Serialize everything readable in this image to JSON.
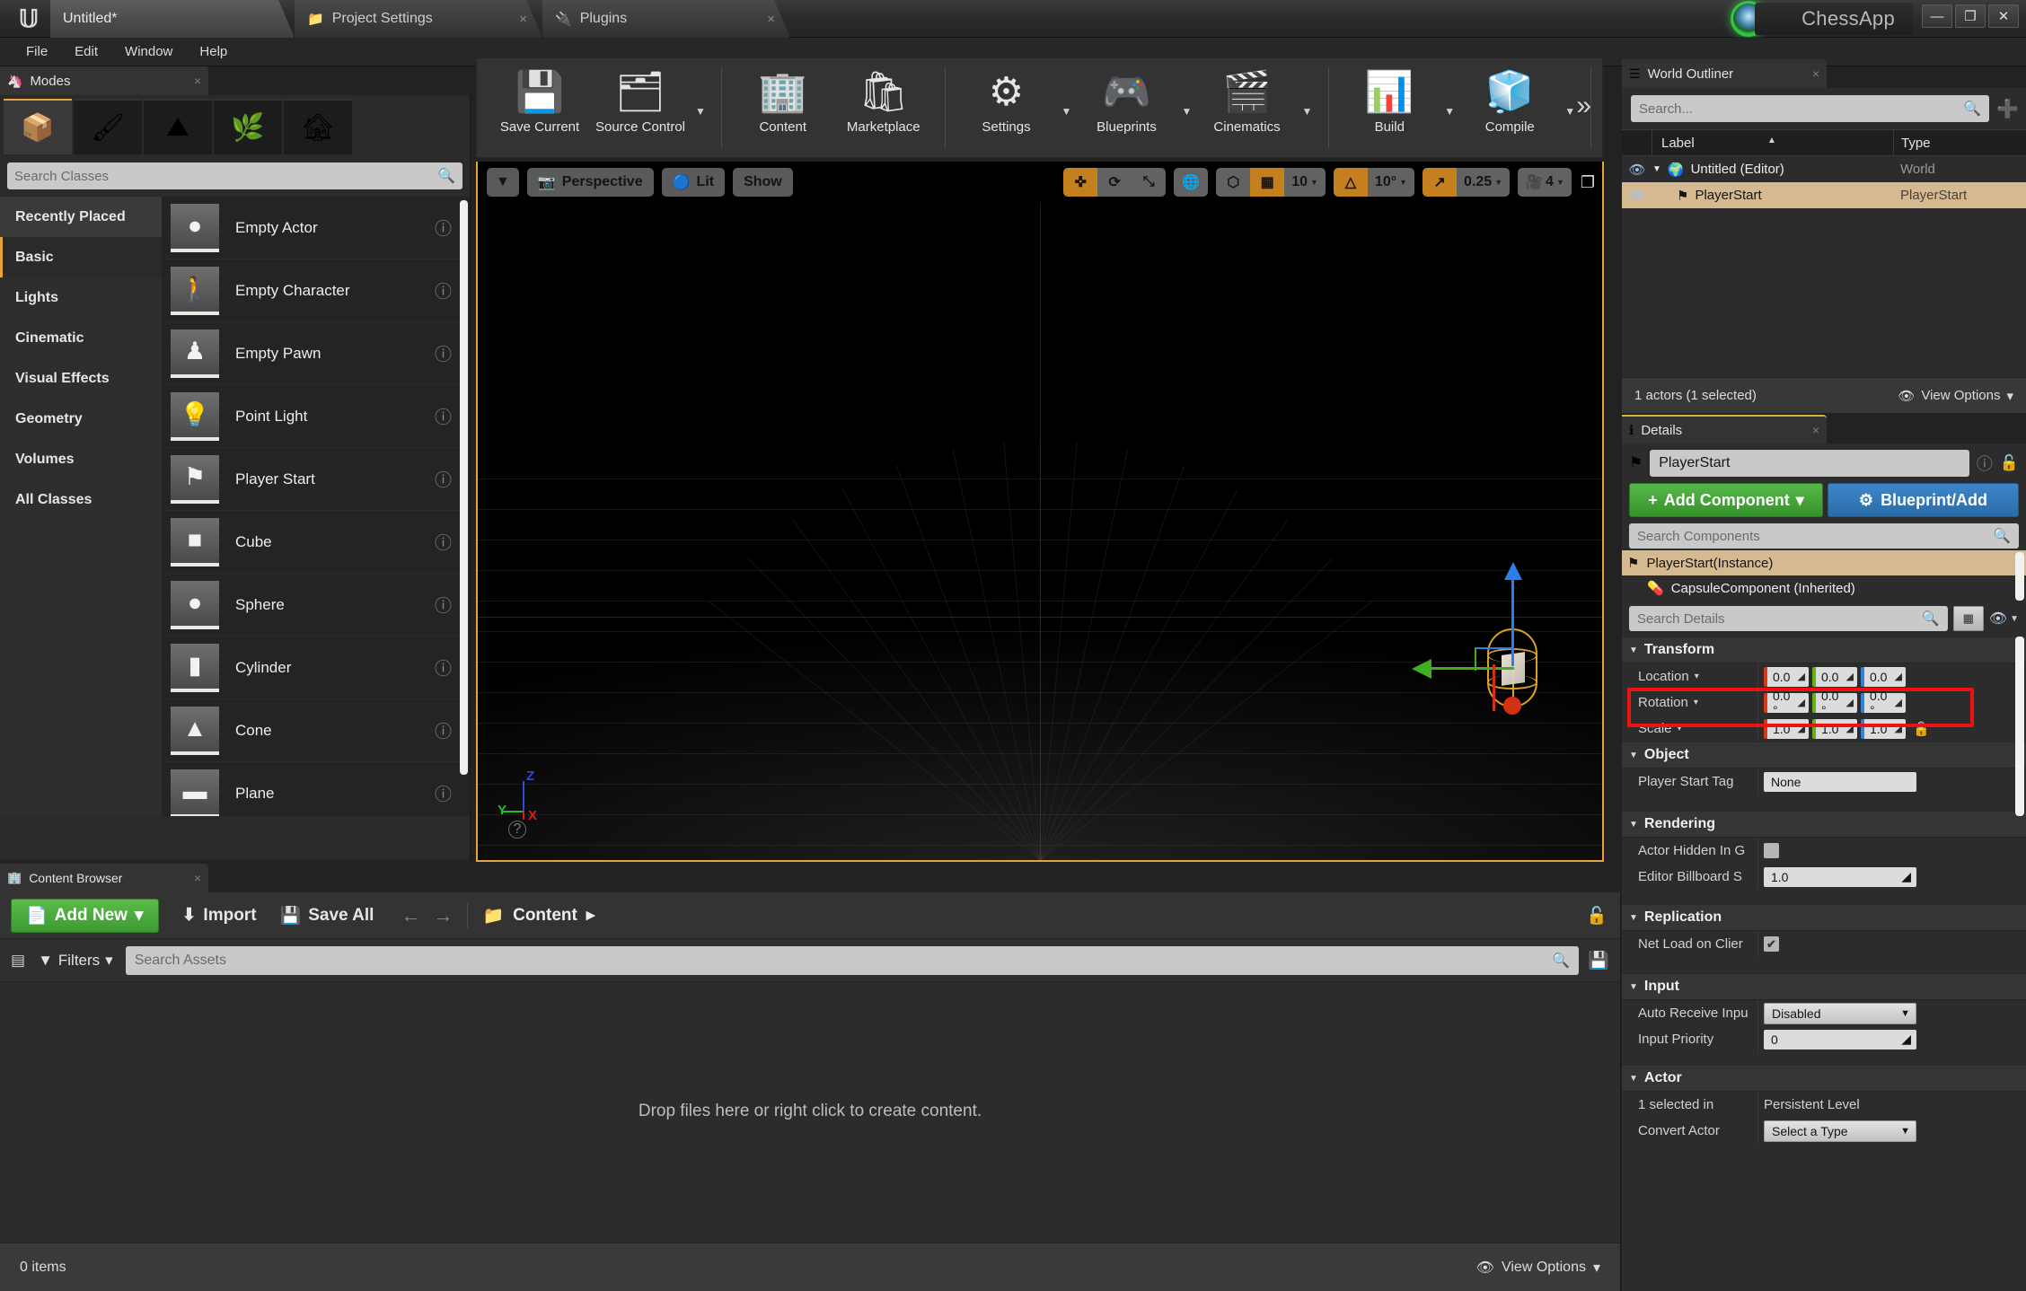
{
  "titlebar": {
    "logo": "ue-logo-icon",
    "tabs": [
      {
        "label": "Untitled*",
        "icon": "",
        "close": "×",
        "active": true
      },
      {
        "label": "Project Settings",
        "icon": "⚙",
        "close": "×",
        "active": false
      },
      {
        "label": "Plugins",
        "icon": "🔌",
        "close": "×",
        "active": false
      }
    ],
    "brand": "ChessApp",
    "window_buttons": {
      "minimize": "—",
      "restore": "❐",
      "close": "✕"
    }
  },
  "menubar": {
    "items": [
      "File",
      "Edit",
      "Window",
      "Help"
    ]
  },
  "modes": {
    "tab_label": "Modes",
    "tab_close": "×",
    "mode_icons": [
      {
        "name": "place-mode-icon",
        "glyph": "📦",
        "selected": true
      },
      {
        "name": "paint-mode-icon",
        "glyph": "🖌",
        "selected": false
      },
      {
        "name": "landscape-mode-icon",
        "glyph": "⛰",
        "selected": false
      },
      {
        "name": "foliage-mode-icon",
        "glyph": "🌿",
        "selected": false
      },
      {
        "name": "geometry-mode-icon",
        "glyph": "🏚",
        "selected": false
      }
    ],
    "search_placeholder": "Search Classes",
    "categories": [
      {
        "label": "Recently Placed",
        "state": "hover"
      },
      {
        "label": "Basic",
        "state": "active"
      },
      {
        "label": "Lights",
        "state": ""
      },
      {
        "label": "Cinematic",
        "state": ""
      },
      {
        "label": "Visual Effects",
        "state": ""
      },
      {
        "label": "Geometry",
        "state": ""
      },
      {
        "label": "Volumes",
        "state": ""
      },
      {
        "label": "All Classes",
        "state": ""
      }
    ],
    "placeables": [
      {
        "label": "Empty Actor",
        "glyph": "●",
        "help": "?"
      },
      {
        "label": "Empty Character",
        "glyph": "🚶",
        "help": "?"
      },
      {
        "label": "Empty Pawn",
        "glyph": "♟",
        "help": "?"
      },
      {
        "label": "Point Light",
        "glyph": "💡",
        "help": "?"
      },
      {
        "label": "Player Start",
        "glyph": "⚑",
        "help": "?"
      },
      {
        "label": "Cube",
        "glyph": "■",
        "help": "?"
      },
      {
        "label": "Sphere",
        "glyph": "●",
        "help": "?"
      },
      {
        "label": "Cylinder",
        "glyph": "▮",
        "help": "?"
      },
      {
        "label": "Cone",
        "glyph": "▲",
        "help": "?"
      },
      {
        "label": "Plane",
        "glyph": "▬",
        "help": "?"
      }
    ]
  },
  "toolbar": {
    "groups": [
      {
        "buttons": [
          {
            "label": "Save Current",
            "icon": "💾",
            "caret": false
          },
          {
            "label": "Source Control",
            "icon": "🗂",
            "caret": true
          }
        ]
      },
      {
        "buttons": [
          {
            "label": "Content",
            "icon": "🏢",
            "caret": false
          },
          {
            "label": "Marketplace",
            "icon": "🛍",
            "caret": false
          }
        ]
      },
      {
        "buttons": [
          {
            "label": "Settings",
            "icon": "⚙",
            "caret": true
          },
          {
            "label": "Blueprints",
            "icon": "🎮",
            "caret": true
          },
          {
            "label": "Cinematics",
            "icon": "🎬",
            "caret": true
          }
        ]
      },
      {
        "buttons": [
          {
            "label": "Build",
            "icon": "📊",
            "caret": true
          },
          {
            "label": "Compile",
            "icon": "🧊",
            "caret": true
          }
        ]
      }
    ],
    "overflow": "»"
  },
  "viewport": {
    "view_menu_caret": "▼",
    "perspective_label": "Perspective",
    "lighting_label": "Lit",
    "show_label": "Show",
    "transform_tools": [
      {
        "name": "translate-tool",
        "glyph": "✜",
        "active": true
      },
      {
        "name": "rotate-tool",
        "glyph": "⟳",
        "active": false
      },
      {
        "name": "scale-tool",
        "glyph": "⤡",
        "active": false
      }
    ],
    "coord_space": {
      "name": "world-space-toggle",
      "glyph": "🌐",
      "active": false
    },
    "surface_snap": {
      "name": "surface-snap-toggle",
      "glyph": "⬡",
      "active": false
    },
    "grid_snap": {
      "name": "grid-snap-toggle",
      "glyph": "▦",
      "active": true
    },
    "grid_size": "10",
    "angle_snap": {
      "name": "angle-snap-toggle",
      "glyph": "△",
      "active": true
    },
    "angle_size": "10°",
    "scale_snap": {
      "name": "scale-snap-toggle",
      "glyph": "↗",
      "active": true
    },
    "scale_size": "0.25",
    "camera_speed_icon": "🎥",
    "camera_speed": "4",
    "maximize_icon": "❐",
    "axis_widget": {
      "x": "X",
      "y": "Y",
      "z": "Z",
      "help": "?"
    }
  },
  "outliner": {
    "tab_label": "World Outliner",
    "tab_close": "×",
    "search_placeholder": "Search...",
    "add_icon": "➕",
    "columns": {
      "label": "Label",
      "type": "Type"
    },
    "rows": [
      {
        "label": "Untitled (Editor)",
        "type": "World",
        "icon": "🌍",
        "expander": "▼",
        "depth": 0,
        "selected": false
      },
      {
        "label": "PlayerStart",
        "type": "PlayerStart",
        "icon": "⚑",
        "expander": "",
        "depth": 1,
        "selected": true
      }
    ],
    "footer_count": "1 actors (1 selected)",
    "view_options": "View Options",
    "view_options_caret": "▾"
  },
  "details": {
    "tab_label": "Details",
    "tab_close": "×",
    "actor_name": "PlayerStart",
    "add_component_label": "Add Component",
    "add_component_plus": "+",
    "add_component_caret": "▾",
    "blueprint_label": "Blueprint/Add",
    "component_search_placeholder": "Search Components",
    "components": [
      {
        "label": "PlayerStart(Instance)",
        "icon": "⚑",
        "selected": true,
        "depth": 0
      },
      {
        "label": "CapsuleComponent (Inherited)",
        "icon": "💊",
        "selected": false,
        "depth": 1
      }
    ],
    "details_search_placeholder": "Search Details",
    "sections": {
      "transform": {
        "title": "Transform",
        "location": {
          "label": "Location",
          "caret": "▾",
          "x": "0.0",
          "y": "0.0",
          "z": "0.0"
        },
        "rotation": {
          "label": "Rotation",
          "caret": "▾",
          "x": "0.0 °",
          "y": "0.0 °",
          "z": "0.0 °"
        },
        "scale": {
          "label": "Scale",
          "caret": "▾",
          "x": "1.0",
          "y": "1.0",
          "z": "1.0",
          "lock": "🔓"
        }
      },
      "object": {
        "title": "Object",
        "player_start_tag_label": "Player Start Tag",
        "player_start_tag_value": "None"
      },
      "rendering": {
        "title": "Rendering",
        "actor_hidden_label": "Actor Hidden In G",
        "actor_hidden_checked": false,
        "billboard_label": "Editor Billboard S",
        "billboard_value": "1.0"
      },
      "replication": {
        "title": "Replication",
        "net_load_label": "Net Load on Clier",
        "net_load_checked": true,
        "check_glyph": "✔"
      },
      "input": {
        "title": "Input",
        "auto_receive_label": "Auto Receive Inpu",
        "auto_receive_value": "Disabled",
        "input_priority_label": "Input Priority",
        "input_priority_value": "0"
      },
      "actor": {
        "title": "Actor",
        "selected_in_label": "1 selected in",
        "selected_in_value": "Persistent Level",
        "convert_actor_label": "Convert Actor",
        "convert_actor_value": "Select a Type"
      }
    },
    "spinner_glyph": "◢",
    "dropdown_caret": "▼"
  },
  "content_browser": {
    "tab_label": "Content Browser",
    "tab_close": "×",
    "add_new_label": "Add New",
    "add_new_icon": "📄",
    "add_new_caret": "▾",
    "import_label": "Import",
    "import_icon": "⬇",
    "save_all_label": "Save All",
    "save_all_icon": "💾",
    "nav_back": "←",
    "nav_forward": "→",
    "breadcrumb_icon": "📁",
    "breadcrumb_label": "Content",
    "breadcrumb_caret": "▸",
    "lock_icon": "🔓",
    "filters_label": "Filters",
    "filters_caret": "▾",
    "filter_icon": "▤",
    "search_placeholder": "Search Assets",
    "save_search_icon": "💾",
    "dropzone_text": "Drop files here or right click to create content.",
    "items_count": "0 items",
    "view_options": "View Options",
    "view_options_caret": "▾"
  },
  "colors": {
    "accent_orange": "#e8a33d",
    "green_button": "#3d9a30",
    "blue_button": "#2a6ba8",
    "highlight_red": "#ee1111",
    "selection_tan": "#d5b991",
    "axis_x": "#d8391b",
    "axis_y": "#62b517",
    "axis_z": "#2f83d6"
  }
}
